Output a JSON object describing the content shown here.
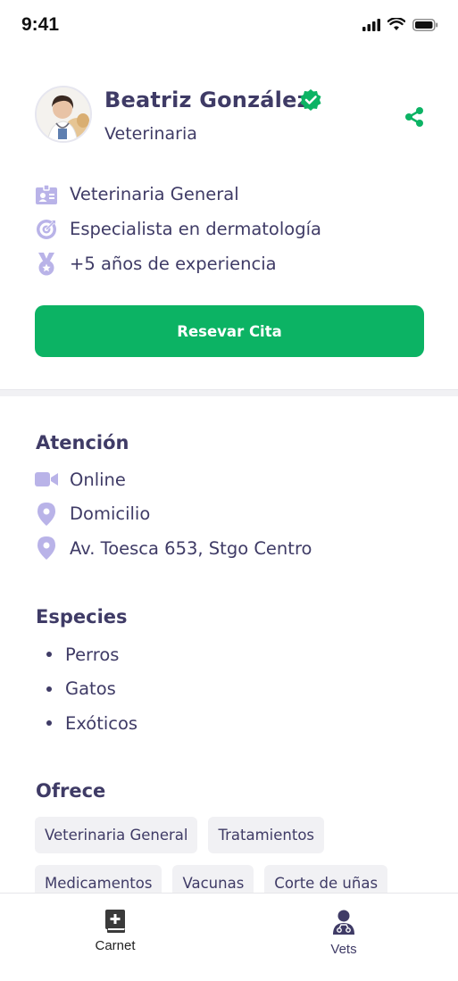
{
  "status_bar": {
    "time": "9:41"
  },
  "profile": {
    "name": "Beatriz González",
    "role": "Veterinaria"
  },
  "facts": [
    {
      "icon": "id-badge-icon",
      "text": "Veterinaria General"
    },
    {
      "icon": "target-icon",
      "text": "Especialista en dermatología"
    },
    {
      "icon": "medal-icon",
      "text": "+5 años de experiencia"
    }
  ],
  "cta_label": "Resevar Cita",
  "attention": {
    "title": "Atención",
    "items": [
      {
        "icon": "video-camera-icon",
        "text": "Online"
      },
      {
        "icon": "map-pin-icon",
        "text": "Domicilio"
      },
      {
        "icon": "map-pin-icon",
        "text": "Av. Toesca 653, Stgo Centro"
      }
    ]
  },
  "species": {
    "title": "Especies",
    "items": [
      "Perros",
      "Gatos",
      "Exóticos"
    ]
  },
  "offers": {
    "title": "Ofrece",
    "rows": [
      [
        "Veterinaria General",
        "Tratamientos"
      ],
      [
        "Medicamentos",
        "Vacunas",
        "Corte de uñas"
      ]
    ]
  },
  "nav": {
    "carnet": "Carnet",
    "vets": "Vets"
  },
  "colors": {
    "accent": "#0cb364",
    "text": "#3f3b66",
    "icon_light": "#b9b3e8"
  }
}
